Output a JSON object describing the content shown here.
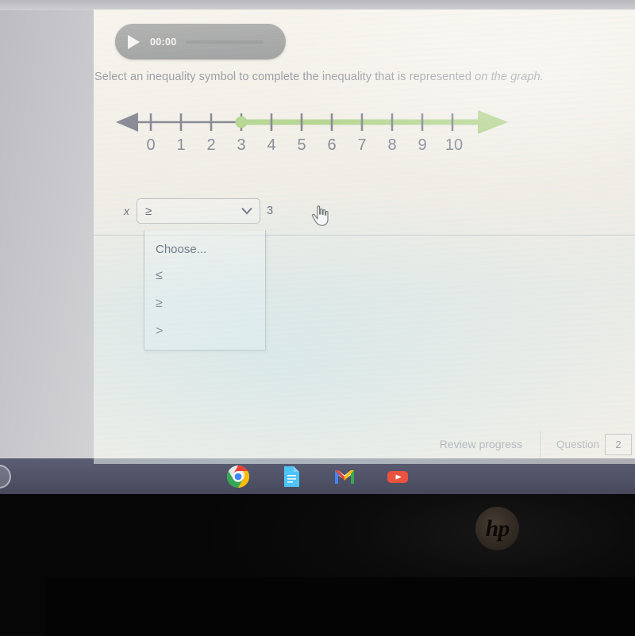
{
  "audio_player": {
    "play_icon": "play-triangle-icon",
    "time": "00:00",
    "progress_percent": 0
  },
  "prompt": {
    "text_normal": "Select an inequality symbol to complete the inequality that is represented ",
    "text_italic": "on the graph."
  },
  "number_line": {
    "labels": [
      "0",
      "1",
      "2",
      "3",
      "4",
      "5",
      "6",
      "7",
      "8",
      "9",
      "10"
    ],
    "min": 0,
    "max": 10,
    "closed_point_value": 3,
    "shaded_direction": "right",
    "shaded_color": "#8cc152",
    "axis_color": "#3a3c52",
    "left_arrow": "arrow-left-icon",
    "right_arrow": "arrow-right-icon",
    "endpoint_style": "closed-circle"
  },
  "inequality": {
    "variable": "x",
    "selected_symbol": "≥",
    "constant": "3",
    "chevron_icon": "chevron-down-icon",
    "cursor_icon": "pointing-hand-cursor"
  },
  "dropdown": {
    "open": true,
    "options": [
      {
        "label": "Choose...",
        "type": "placeholder"
      },
      {
        "label": "≤",
        "type": "symbol"
      },
      {
        "label": "≥",
        "type": "symbol"
      },
      {
        "label": ">",
        "type": "symbol"
      }
    ]
  },
  "footer": {
    "review_progress_label": "Review progress",
    "question_label": "Question",
    "question_number": "2"
  },
  "shelf": {
    "launcher_icon": "chromeos-launcher-icon",
    "icons": [
      {
        "name": "chrome-icon",
        "label": "Chrome"
      },
      {
        "name": "google-docs-icon",
        "label": "Docs"
      },
      {
        "name": "gmail-icon",
        "label": "Gmail"
      },
      {
        "name": "youtube-icon",
        "label": "YouTube"
      }
    ]
  },
  "device": {
    "brand_logo": "hp"
  },
  "colors": {
    "green": "#8cc152",
    "axis": "#3a3c52",
    "text": "#3b3f55",
    "player_bg": "#3b3f47",
    "shelf_bg": "#4f5166"
  }
}
